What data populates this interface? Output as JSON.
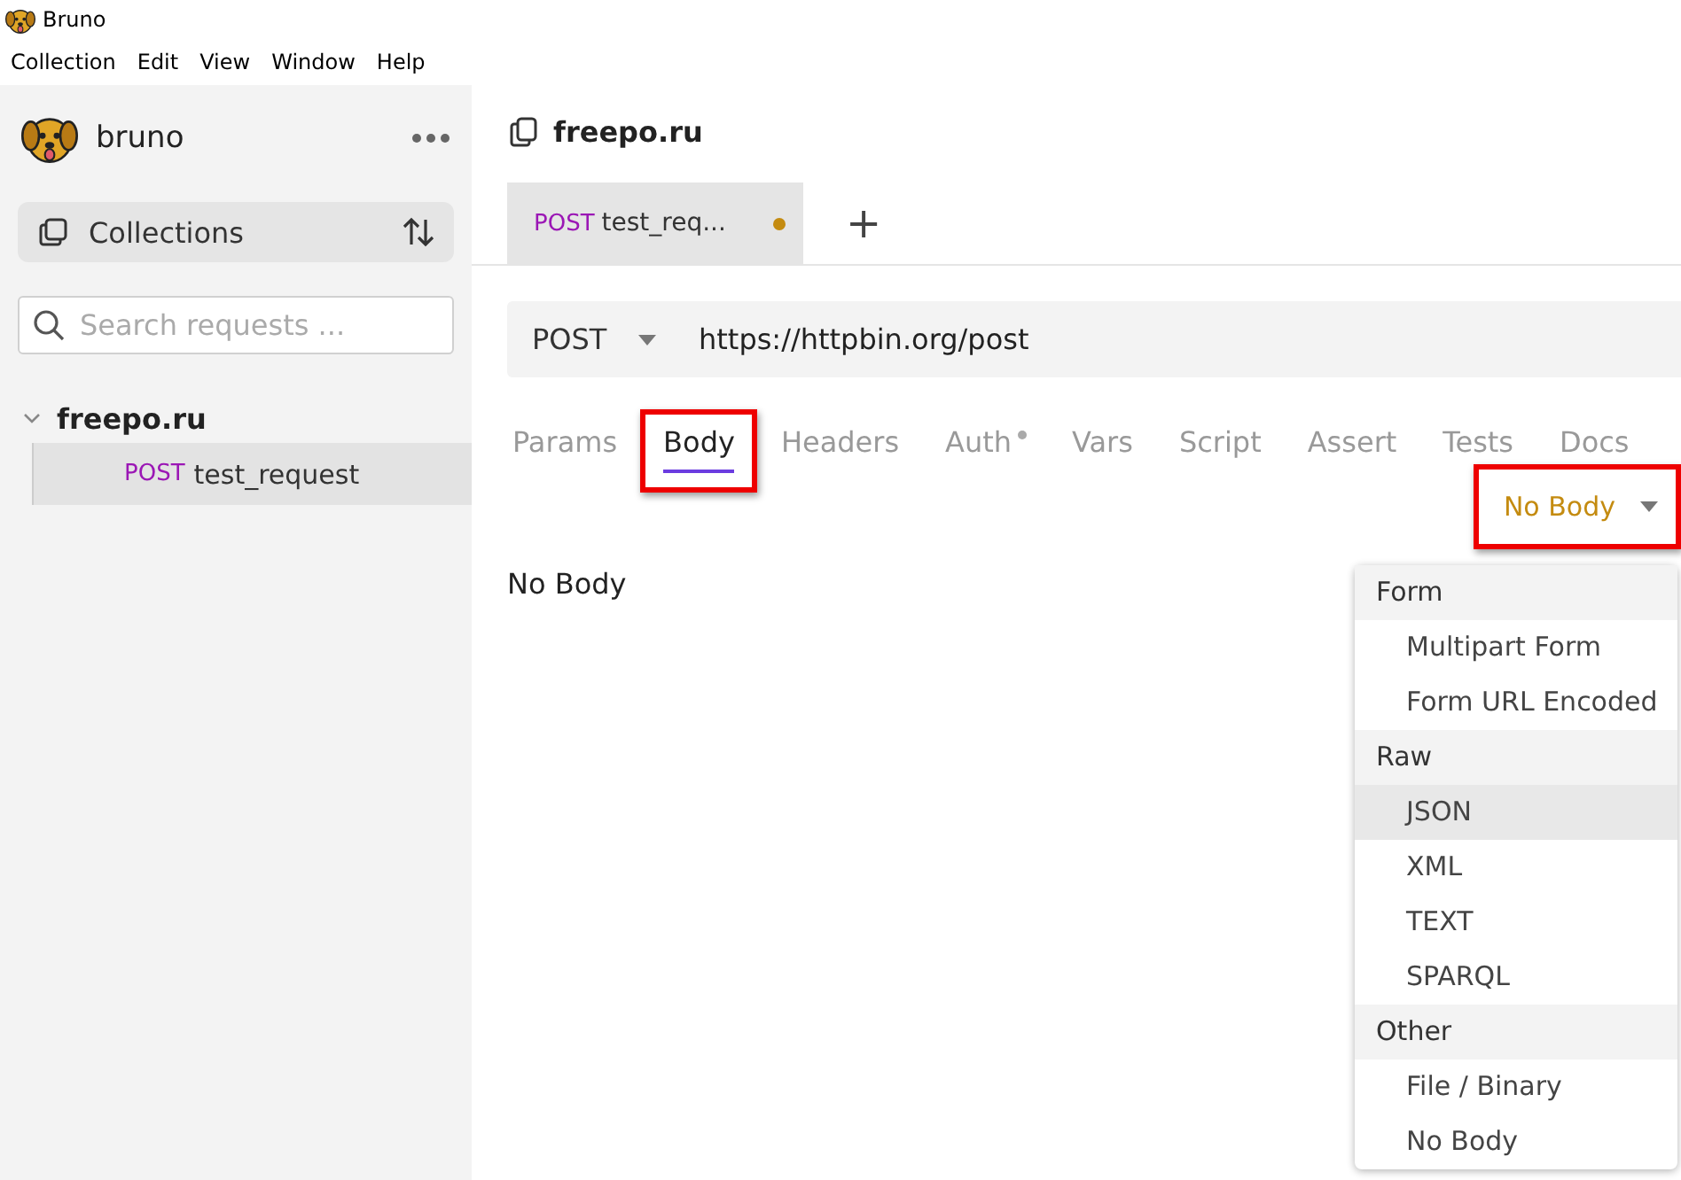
{
  "window": {
    "title": "Bruno"
  },
  "menu_bar": [
    "Collection",
    "Edit",
    "View",
    "Window",
    "Help"
  ],
  "sidebar": {
    "app_name": "bruno",
    "collections_button": "Collections",
    "search": {
      "placeholder": "Search requests ..."
    },
    "tree": [
      {
        "name": "freepo.ru",
        "expanded": true,
        "children": [
          {
            "method": "POST",
            "name": "test_request",
            "selected": true
          }
        ]
      }
    ]
  },
  "collection_title": "freepo.ru",
  "request_tabs": [
    {
      "method": "POST",
      "label": "test_req...",
      "modified": true,
      "selected": true
    }
  ],
  "new_tab_button": "+",
  "url_bar": {
    "method": "POST",
    "url": "https://httpbin.org/post"
  },
  "pane_tabs": [
    {
      "label": "Params",
      "selected": false,
      "indicator": false,
      "highlighted": false
    },
    {
      "label": "Body",
      "selected": true,
      "indicator": false,
      "highlighted": true
    },
    {
      "label": "Headers",
      "selected": false,
      "indicator": false,
      "highlighted": false
    },
    {
      "label": "Auth",
      "selected": false,
      "indicator": true,
      "highlighted": false
    },
    {
      "label": "Vars",
      "selected": false,
      "indicator": false,
      "highlighted": false
    },
    {
      "label": "Script",
      "selected": false,
      "indicator": false,
      "highlighted": false
    },
    {
      "label": "Assert",
      "selected": false,
      "indicator": false,
      "highlighted": false
    },
    {
      "label": "Tests",
      "selected": false,
      "indicator": false,
      "highlighted": false
    },
    {
      "label": "Docs",
      "selected": false,
      "indicator": false,
      "highlighted": false
    }
  ],
  "body_mode": {
    "label": "No Body",
    "highlighted": true
  },
  "body_content": "No Body",
  "body_mode_menu": [
    {
      "kind": "header",
      "label": "Form"
    },
    {
      "kind": "option",
      "label": "Multipart Form",
      "hovered": false
    },
    {
      "kind": "option",
      "label": "Form URL Encoded",
      "hovered": false
    },
    {
      "kind": "header",
      "label": "Raw"
    },
    {
      "kind": "option",
      "label": "JSON",
      "hovered": true
    },
    {
      "kind": "option",
      "label": "XML",
      "hovered": false
    },
    {
      "kind": "option",
      "label": "TEXT",
      "hovered": false
    },
    {
      "kind": "option",
      "label": "SPARQL",
      "hovered": false
    },
    {
      "kind": "header",
      "label": "Other"
    },
    {
      "kind": "option",
      "label": "File / Binary",
      "hovered": false
    },
    {
      "kind": "option",
      "label": "No Body",
      "hovered": false
    }
  ]
}
